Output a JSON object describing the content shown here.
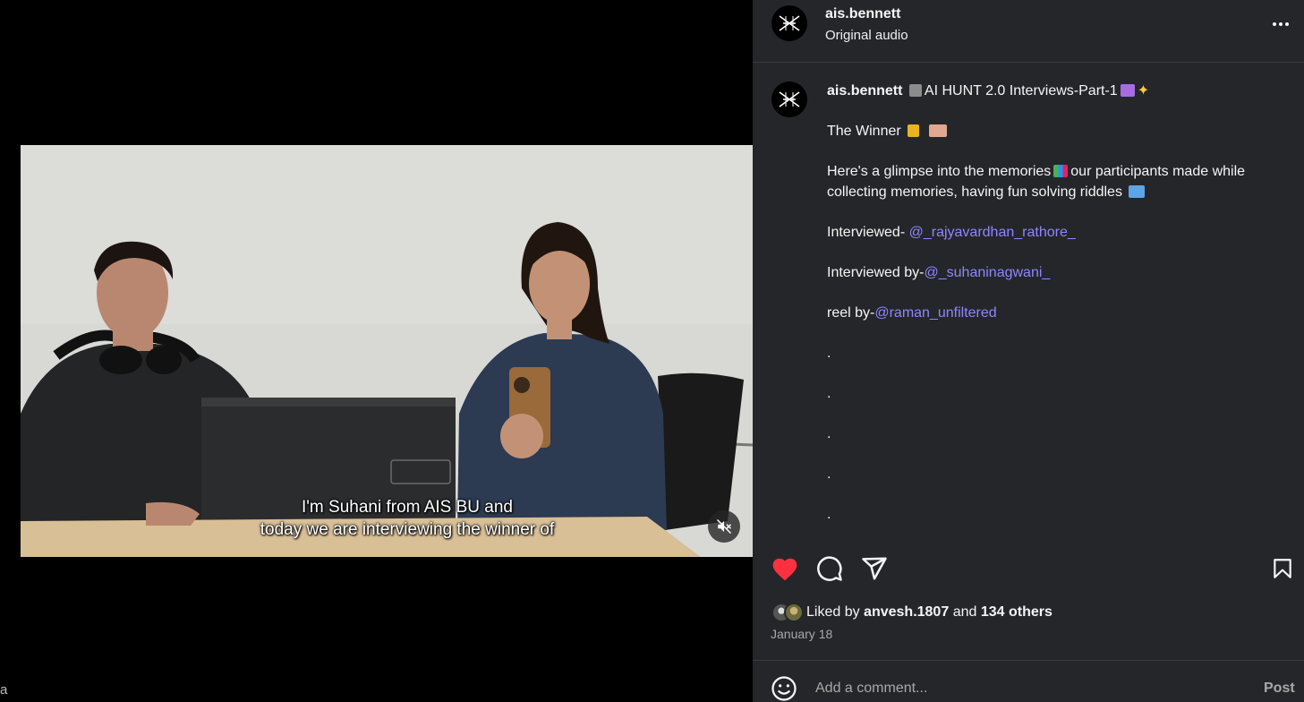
{
  "post": {
    "username": "ais.bennett",
    "audio": "Original audio",
    "date": "January 18"
  },
  "video": {
    "subtitle_line_1": "I'm Suhani from AIS BU and",
    "subtitle_line_2": "today we are interviewing the winner of",
    "muted": true,
    "corner_text": "a"
  },
  "caption": {
    "username": "ais.bennett",
    "title_text": "AI HUNT 2.0 Interviews-Part-1",
    "winner_text": "The Winner",
    "glimpse_text_1": "Here's a glimpse into the memories",
    "glimpse_text_2": "our participants made while collecting memories, having fun solving riddles",
    "interviewed_prefix": "Interviewed-",
    "interviewed_mention": "@_rajyavardhan_rathore_",
    "interviewed_by_prefix": "Interviewed by-",
    "interviewed_by_mention": "@_suhaninagwani_",
    "reel_by_prefix": "reel by-",
    "reel_by_mention": "@raman_unfiltered",
    "dots": [
      ".",
      ".",
      ".",
      ".",
      "."
    ]
  },
  "likes": {
    "prefix": "Liked by",
    "top_liker": "anvesh.1807",
    "middle": "and",
    "others": "134 others"
  },
  "comment_box": {
    "placeholder": "Add a comment...",
    "post_label": "Post"
  },
  "icons": {
    "like": "heart-filled-icon",
    "comment": "speech-bubble-icon",
    "share": "paper-plane-icon",
    "save": "bookmark-icon",
    "emoji": "smiley-icon",
    "more": "ellipsis-icon",
    "mute": "speaker-muted-icon"
  },
  "colors": {
    "sidebar_bg": "#25262a",
    "like_red": "#ff3040",
    "mention": "#8f86ff",
    "muted_text": "#a8a8a8"
  }
}
